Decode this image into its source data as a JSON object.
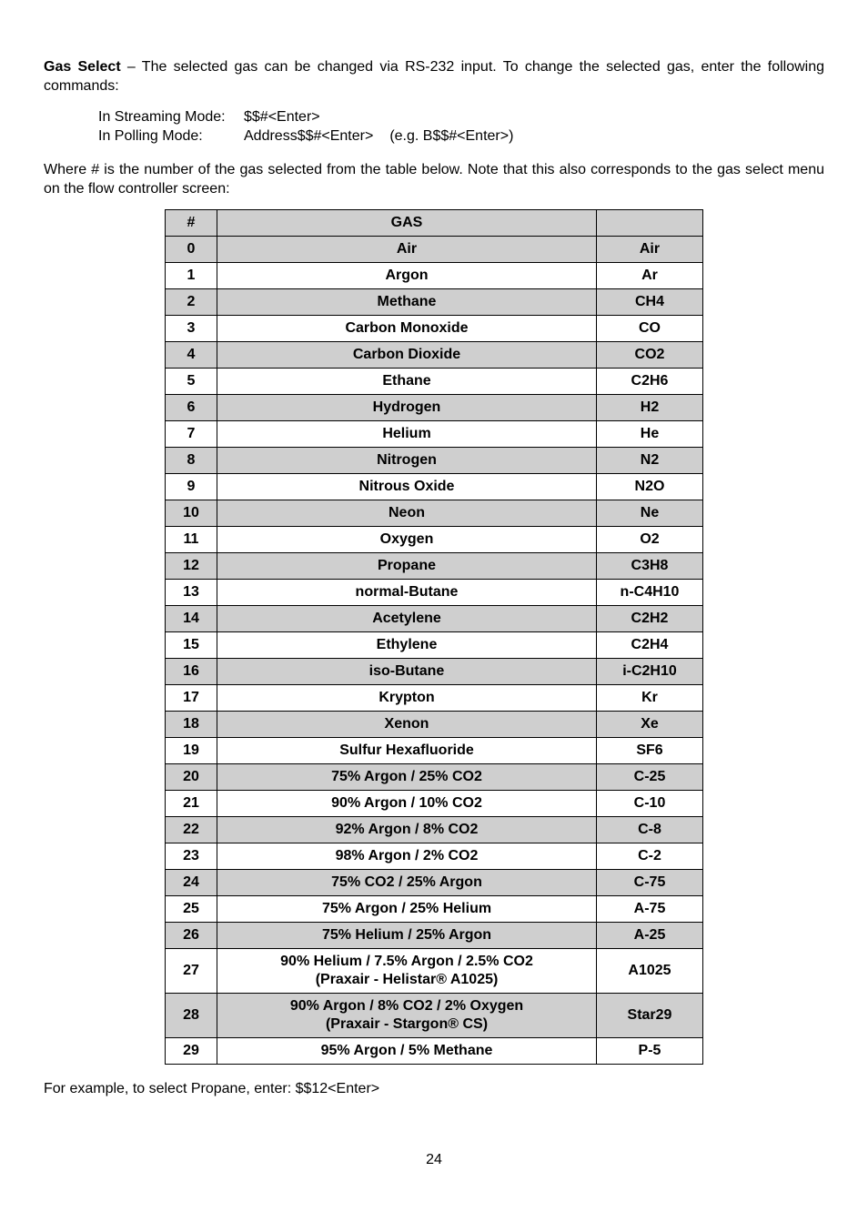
{
  "intro": {
    "title": "Gas Select",
    "body": " – The selected gas can be changed via RS-232 input. To change the selected gas, enter the following commands:"
  },
  "commands": {
    "streaming_label": "In Streaming Mode:",
    "streaming_val": "$$#<Enter>",
    "polling_label": "In Polling Mode:",
    "polling_val": "Address$$#<Enter>",
    "polling_eg": "(e.g. B$$#<Enter>)"
  },
  "explain": "Where # is the number of the gas selected from the table below. Note that this also corresponds to the gas select menu on the flow controller screen:",
  "headers": {
    "num": "#",
    "gas": "GAS",
    "sym": ""
  },
  "rows": [
    {
      "n": "0",
      "gas": "Air",
      "sym": "Air",
      "shade": true
    },
    {
      "n": "1",
      "gas": "Argon",
      "sym": "Ar"
    },
    {
      "n": "2",
      "gas": "Methane",
      "sym": "CH4",
      "shade": true
    },
    {
      "n": "3",
      "gas": "Carbon Monoxide",
      "sym": "CO"
    },
    {
      "n": "4",
      "gas": "Carbon Dioxide",
      "sym": "CO2",
      "shade": true
    },
    {
      "n": "5",
      "gas": "Ethane",
      "sym": "C2H6"
    },
    {
      "n": "6",
      "gas": "Hydrogen",
      "sym": "H2",
      "shade": true
    },
    {
      "n": "7",
      "gas": "Helium",
      "sym": "He"
    },
    {
      "n": "8",
      "gas": "Nitrogen",
      "sym": "N2",
      "shade": true
    },
    {
      "n": "9",
      "gas": "Nitrous Oxide",
      "sym": "N2O"
    },
    {
      "n": "10",
      "gas": "Neon",
      "sym": "Ne",
      "shade": true
    },
    {
      "n": "11",
      "gas": "Oxygen",
      "sym": "O2"
    },
    {
      "n": "12",
      "gas": "Propane",
      "sym": "C3H8",
      "shade": true
    },
    {
      "n": "13",
      "gas": "normal-Butane",
      "sym": "n-C4H10"
    },
    {
      "n": "14",
      "gas": "Acetylene",
      "sym": "C2H2",
      "shade": true
    },
    {
      "n": "15",
      "gas": "Ethylene",
      "sym": "C2H4"
    },
    {
      "n": "16",
      "gas": "iso-Butane",
      "sym": "i-C2H10",
      "shade": true
    },
    {
      "n": "17",
      "gas": "Krypton",
      "sym": "Kr"
    },
    {
      "n": "18",
      "gas": "Xenon",
      "sym": "Xe",
      "shade": true
    },
    {
      "n": "19",
      "gas": "Sulfur Hexafluoride",
      "sym": "SF6"
    },
    {
      "n": "20",
      "gas": "75% Argon / 25% CO2",
      "sym": "C-25",
      "shade": true
    },
    {
      "n": "21",
      "gas": "90% Argon / 10% CO2",
      "sym": "C-10"
    },
    {
      "n": "22",
      "gas": "92% Argon / 8% CO2",
      "sym": "C-8",
      "shade": true
    },
    {
      "n": "23",
      "gas": "98% Argon / 2% CO2",
      "sym": "C-2"
    },
    {
      "n": "24",
      "gas": "75% CO2 / 25% Argon",
      "sym": "C-75",
      "shade": true
    },
    {
      "n": "25",
      "gas": "75% Argon / 25% Helium",
      "sym": "A-75"
    },
    {
      "n": "26",
      "gas": "75% Helium / 25% Argon",
      "sym": "A-25",
      "shade": true
    },
    {
      "n": "27",
      "gas": "90% Helium / 7.5% Argon / 2.5% CO2\n(Praxair - Helistar® A1025)",
      "sym": "A1025"
    },
    {
      "n": "28",
      "gas": "90% Argon / 8% CO2 / 2% Oxygen\n(Praxair - Stargon® CS)",
      "sym": "Star29",
      "shade": true
    },
    {
      "n": "29",
      "gas": "95% Argon / 5% Methane",
      "sym": "P-5"
    }
  ],
  "example": "For example, to select Propane, enter:  $$12<Enter>",
  "page_number": "24"
}
